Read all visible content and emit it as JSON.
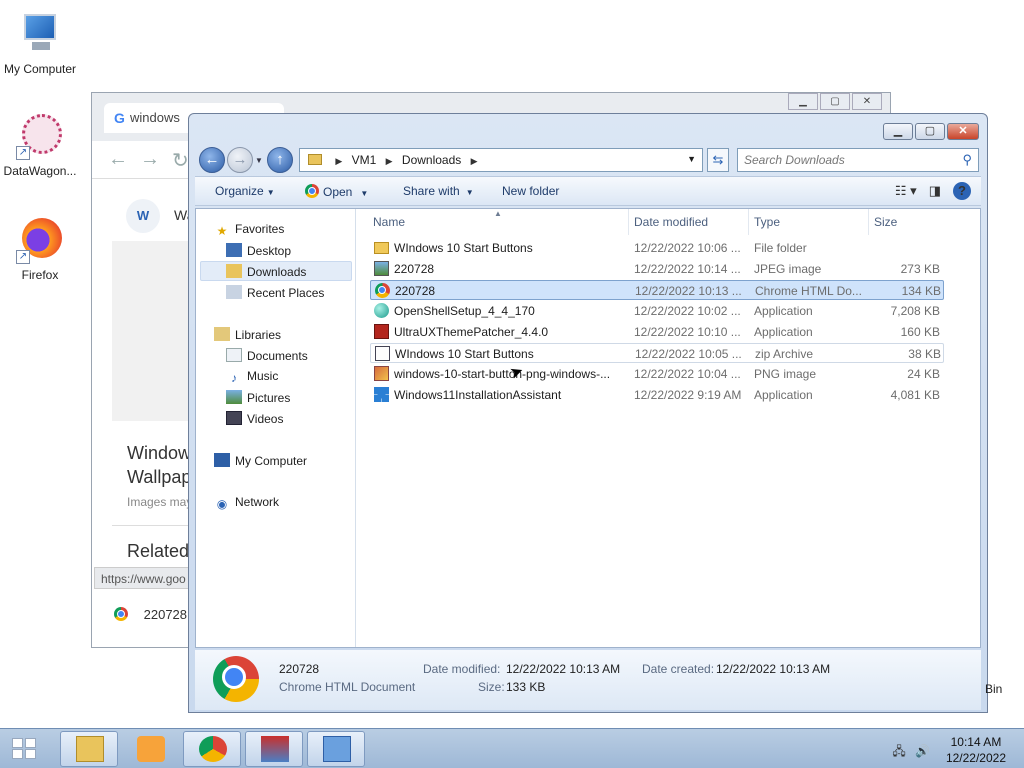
{
  "desktop": {
    "icons": [
      {
        "label": "My Computer"
      },
      {
        "label": "DataWagon..."
      },
      {
        "label": "Firefox"
      }
    ],
    "recycle_bin_partial": "Bin"
  },
  "background_window": {
    "tab_title": "windows",
    "site_label_partial": "Wa",
    "headline_line1": "Window",
    "headline_line2": "Wallpap",
    "images_note": "Images may",
    "related": "Related",
    "status_url": "https://www.goo",
    "download_item": "220728."
  },
  "explorer": {
    "address": {
      "segments": [
        "VM1",
        "Downloads"
      ],
      "search_placeholder": "Search Downloads"
    },
    "toolbar": {
      "organize": "Organize",
      "open": "Open",
      "share_with": "Share with",
      "new_folder": "New folder"
    },
    "nav": {
      "favorites": "Favorites",
      "desktop": "Desktop",
      "downloads": "Downloads",
      "recent_places": "Recent Places",
      "libraries": "Libraries",
      "documents": "Documents",
      "music": "Music",
      "pictures": "Pictures",
      "videos": "Videos",
      "my_computer": "My Computer",
      "network": "Network"
    },
    "columns": {
      "name": "Name",
      "date_modified": "Date modified",
      "type": "Type",
      "size": "Size"
    },
    "files": [
      {
        "name": "WIndows 10 Start Buttons",
        "date": "12/22/2022 10:06 ...",
        "type": "File folder",
        "size": "",
        "icon": "folder-icon"
      },
      {
        "name": "220728",
        "date": "12/22/2022 10:14 ...",
        "type": "JPEG image",
        "size": "273 KB",
        "icon": "jpeg-file-icon"
      },
      {
        "name": "220728",
        "date": "12/22/2022 10:13 ...",
        "type": "Chrome HTML Do...",
        "size": "134 KB",
        "icon": "chrome-file-icon"
      },
      {
        "name": "OpenShellSetup_4_4_170",
        "date": "12/22/2022 10:02 ...",
        "type": "Application",
        "size": "7,208 KB",
        "icon": "application-icon"
      },
      {
        "name": "UltraUXThemePatcher_4.4.0",
        "date": "12/22/2022 10:10 ...",
        "type": "Application",
        "size": "160 KB",
        "icon": "application-icon"
      },
      {
        "name": "WIndows 10 Start Buttons",
        "date": "12/22/2022 10:05 ...",
        "type": "zip Archive",
        "size": "38 KB",
        "icon": "zip-archive-icon"
      },
      {
        "name": "windows-10-start-button-png-windows-...",
        "date": "12/22/2022 10:04 ...",
        "type": "PNG image",
        "size": "24 KB",
        "icon": "png-file-icon"
      },
      {
        "name": "Windows11InstallationAssistant",
        "date": "12/22/2022 9:19 AM",
        "type": "Application",
        "size": "4,081 KB",
        "icon": "windows-logo-icon"
      }
    ],
    "details": {
      "name": "220728",
      "type": "Chrome HTML Document",
      "date_modified_label": "Date modified:",
      "date_modified": "12/22/2022 10:13 AM",
      "date_created_label": "Date created:",
      "date_created": "12/22/2022 10:13 AM",
      "size_label": "Size:",
      "size": "133 KB"
    }
  },
  "taskbar": {
    "time": "10:14 AM",
    "date": "12/22/2022"
  }
}
